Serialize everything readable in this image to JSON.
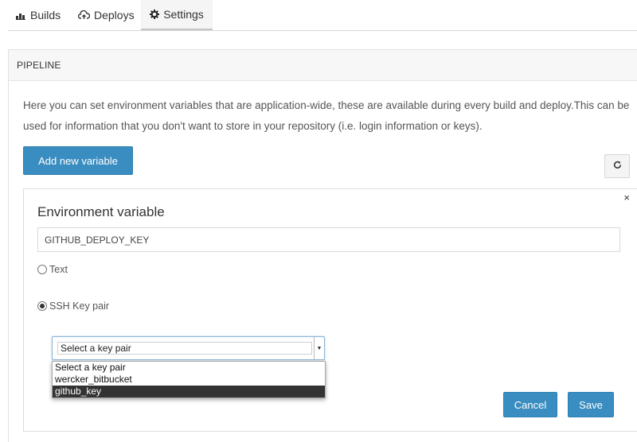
{
  "tabs": [
    {
      "label": "Builds",
      "icon": "builds-icon"
    },
    {
      "label": "Deploys",
      "icon": "cloud-upload-icon"
    },
    {
      "label": "Settings",
      "icon": "gear-icon"
    }
  ],
  "active_tab": "Settings",
  "panel": {
    "title": "PIPELINE",
    "description": "Here you can set environment variables that are application-wide, these are available during every build and deploy.This can be used for information that you don't want to store in your repository (i.e. login information or keys).",
    "add_button": "Add new variable",
    "refresh_icon": "refresh-icon"
  },
  "env_form": {
    "close": "×",
    "title": "Environment variable",
    "name_value": "GITHUB_DEPLOY_KEY",
    "type_options": [
      {
        "label": "Text",
        "checked": false
      },
      {
        "label": "SSH Key pair",
        "checked": true
      }
    ],
    "key_select": {
      "value": "Select a key pair",
      "options": [
        "Select a key pair",
        "wercker_bitbucket",
        "github_key"
      ],
      "highlighted": "github_key"
    },
    "cancel": "Cancel",
    "save": "Save"
  },
  "colors": {
    "primary_button": "#3a8dc0",
    "highlight_option": "#333333"
  }
}
